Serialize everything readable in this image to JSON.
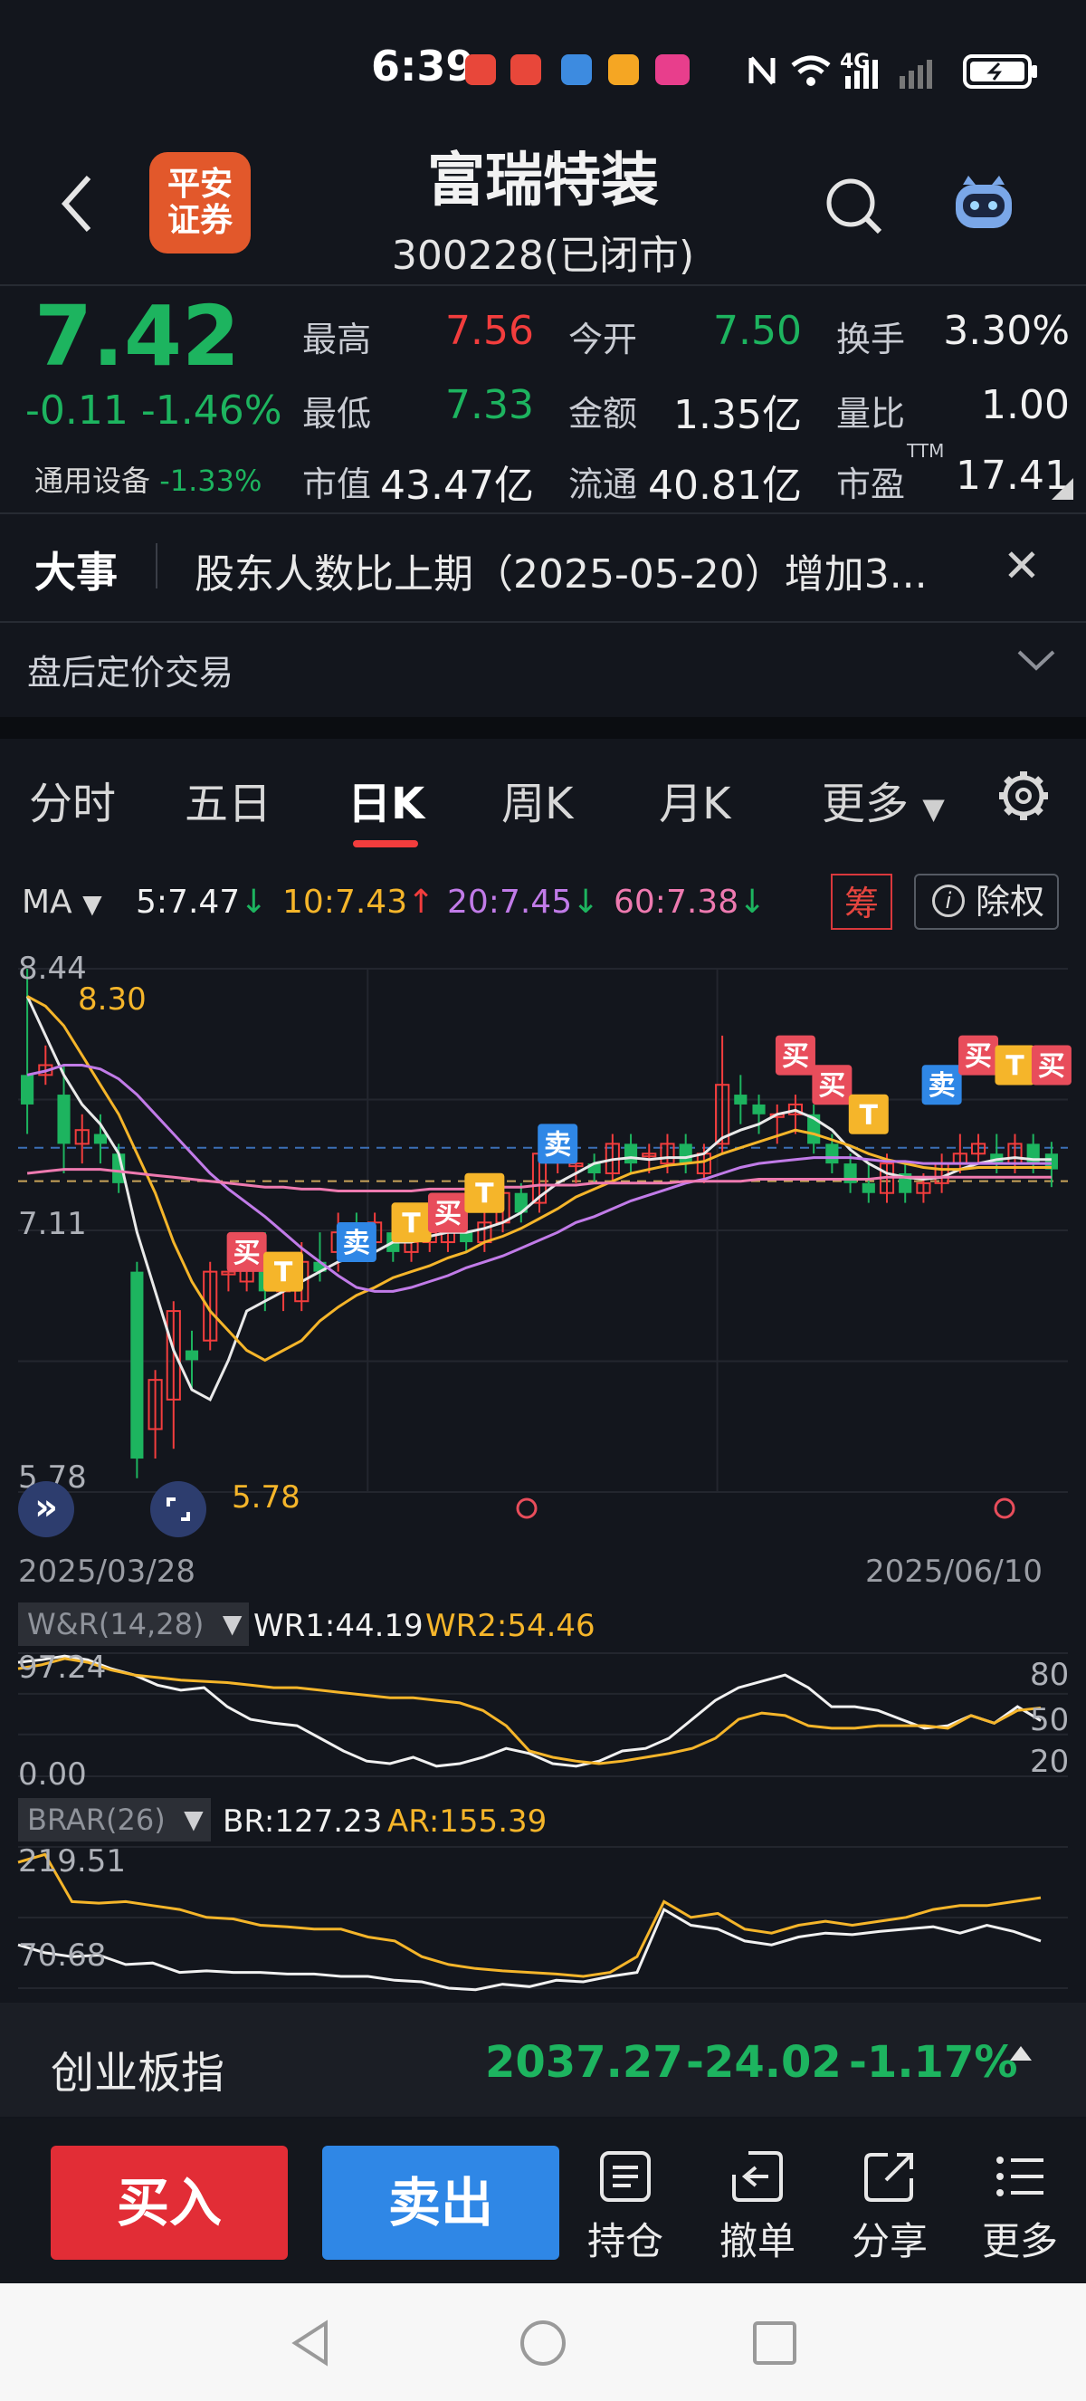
{
  "status_bar": {
    "time": "6:39",
    "network": "4G"
  },
  "header": {
    "broker_logo": "平安\n证券",
    "stock_name": "富瑞特装",
    "stock_code": "300228(已闭市)"
  },
  "quote": {
    "price": "7.42",
    "change": "-0.11",
    "change_pct": "-1.46%",
    "sector_name": "通用设备",
    "sector_pct": "-1.33%",
    "fields": [
      {
        "label": "最高",
        "value": "7.56",
        "color": "#f23d3d"
      },
      {
        "label": "今开",
        "value": "7.50",
        "color": "#1db45f"
      },
      {
        "label": "换手",
        "value": "3.30%",
        "color": "#f1f1f1"
      },
      {
        "label": "最低",
        "value": "7.33",
        "color": "#1db45f"
      },
      {
        "label": "金额",
        "value": "1.35亿",
        "color": "#f1f1f1"
      },
      {
        "label": "量比",
        "value": "1.00",
        "color": "#f1f1f1"
      },
      {
        "label": "市值",
        "value": "43.47亿",
        "color": "#f1f1f1"
      },
      {
        "label": "流通",
        "value": "40.81亿",
        "color": "#f1f1f1"
      },
      {
        "label": "市盈",
        "value": "17.41",
        "color": "#f1f1f1",
        "superscript": "TTM"
      }
    ]
  },
  "news": {
    "tag": "大事",
    "text": "股东人数比上期（2025-05-20）增加3...",
    "after_hours": "盘后定价交易"
  },
  "tabs": [
    {
      "label": "分时",
      "active": false
    },
    {
      "label": "五日",
      "active": false
    },
    {
      "label": "日K",
      "active": true
    },
    {
      "label": "周K",
      "active": false
    },
    {
      "label": "月K",
      "active": false
    },
    {
      "label": "更多",
      "active": false
    }
  ],
  "ma_row": {
    "label": "MA",
    "items": [
      {
        "text": "5:7.47",
        "arrow": "↓",
        "color": "#f1f1f1",
        "arrow_color": "#1db45f"
      },
      {
        "text": "10:7.43",
        "arrow": "↑",
        "color": "#f5b52a",
        "arrow_color": "#f23d3d"
      },
      {
        "text": "20:7.45",
        "arrow": "↓",
        "color": "#c17be8",
        "arrow_color": "#1db45f"
      },
      {
        "text": "60:7.38",
        "arrow": "↓",
        "color": "#ee7ab0",
        "arrow_color": "#1db45f"
      }
    ],
    "chou_label": "筹",
    "chuquan_label": "除权"
  },
  "kline": {
    "y_high_label": "8.44",
    "y_mid_label": "7.11",
    "y_low_label": "5.78",
    "max_marker": "8.30",
    "min_marker": "5.78",
    "date_start": "2025/03/28",
    "date_end": "2025/06/10",
    "signal_buy": "买",
    "signal_sell": "卖",
    "signal_t": "T"
  },
  "chart_data": [
    {
      "type": "candlestick",
      "title": "日K",
      "x_range": [
        "2025/03/28",
        "2025/06/10"
      ],
      "ylim": [
        5.78,
        8.44
      ],
      "y_ticks": [
        8.44,
        7.11,
        5.78
      ],
      "candles": [
        {
          "o": 7.9,
          "c": 7.75,
          "h": 8.44,
          "l": 7.6
        },
        {
          "o": 7.9,
          "c": 7.95,
          "h": 8.05,
          "l": 7.85
        },
        {
          "o": 7.8,
          "c": 7.55,
          "h": 7.95,
          "l": 7.4
        },
        {
          "o": 7.55,
          "c": 7.62,
          "h": 7.7,
          "l": 7.45
        },
        {
          "o": 7.6,
          "c": 7.55,
          "h": 7.7,
          "l": 7.45
        },
        {
          "o": 7.5,
          "c": 7.35,
          "h": 7.55,
          "l": 7.3
        },
        {
          "o": 6.9,
          "c": 5.95,
          "h": 6.95,
          "l": 5.85
        },
        {
          "o": 6.1,
          "c": 6.35,
          "h": 6.4,
          "l": 5.95
        },
        {
          "o": 6.25,
          "c": 6.7,
          "h": 6.75,
          "l": 6.0
        },
        {
          "o": 6.5,
          "c": 6.45,
          "h": 6.6,
          "l": 6.3
        },
        {
          "o": 6.55,
          "c": 6.9,
          "h": 6.95,
          "l": 6.5
        },
        {
          "o": 6.9,
          "c": 6.9,
          "h": 6.95,
          "l": 6.8
        },
        {
          "o": 6.85,
          "c": 6.95,
          "h": 7.05,
          "l": 6.8
        },
        {
          "o": 6.95,
          "c": 6.8,
          "h": 7.1,
          "l": 6.7
        },
        {
          "o": 6.8,
          "c": 6.85,
          "h": 6.95,
          "l": 6.7
        },
        {
          "o": 6.75,
          "c": 6.95,
          "h": 7.05,
          "l": 6.7
        },
        {
          "o": 6.95,
          "c": 6.9,
          "h": 7.1,
          "l": 6.85
        },
        {
          "o": 7.0,
          "c": 7.1,
          "h": 7.2,
          "l": 6.9
        },
        {
          "o": 7.1,
          "c": 7.05,
          "h": 7.2,
          "l": 6.95
        },
        {
          "o": 7.05,
          "c": 7.15,
          "h": 7.2,
          "l": 7.0
        },
        {
          "o": 7.1,
          "c": 7.0,
          "h": 7.15,
          "l": 6.95
        },
        {
          "o": 7.0,
          "c": 7.05,
          "h": 7.2,
          "l": 6.95
        },
        {
          "o": 7.05,
          "c": 7.1,
          "h": 7.15,
          "l": 7.0
        },
        {
          "o": 7.05,
          "c": 7.15,
          "h": 7.25,
          "l": 7.0
        },
        {
          "o": 7.1,
          "c": 7.05,
          "h": 7.15,
          "l": 7.0
        },
        {
          "o": 7.05,
          "c": 7.15,
          "h": 7.2,
          "l": 7.0
        },
        {
          "o": 7.15,
          "c": 7.3,
          "h": 7.35,
          "l": 7.1
        },
        {
          "o": 7.3,
          "c": 7.2,
          "h": 7.35,
          "l": 7.15
        },
        {
          "o": 7.25,
          "c": 7.5,
          "h": 7.6,
          "l": 7.2
        },
        {
          "o": 7.5,
          "c": 7.55,
          "h": 7.6,
          "l": 7.4
        },
        {
          "o": 7.45,
          "c": 7.45,
          "h": 7.55,
          "l": 7.35
        },
        {
          "o": 7.45,
          "c": 7.4,
          "h": 7.5,
          "l": 7.35
        },
        {
          "o": 7.4,
          "c": 7.55,
          "h": 7.6,
          "l": 7.35
        },
        {
          "o": 7.55,
          "c": 7.45,
          "h": 7.6,
          "l": 7.4
        },
        {
          "o": 7.5,
          "c": 7.5,
          "h": 7.55,
          "l": 7.4
        },
        {
          "o": 7.45,
          "c": 7.55,
          "h": 7.6,
          "l": 7.4
        },
        {
          "o": 7.55,
          "c": 7.45,
          "h": 7.6,
          "l": 7.4
        },
        {
          "o": 7.4,
          "c": 7.5,
          "h": 7.55,
          "l": 7.35
        },
        {
          "o": 7.55,
          "c": 7.85,
          "h": 8.1,
          "l": 7.5
        },
        {
          "o": 7.8,
          "c": 7.75,
          "h": 7.9,
          "l": 7.65
        },
        {
          "o": 7.75,
          "c": 7.7,
          "h": 7.8,
          "l": 7.6
        },
        {
          "o": 7.7,
          "c": 7.7,
          "h": 7.75,
          "l": 7.55
        },
        {
          "o": 7.7,
          "c": 7.75,
          "h": 7.8,
          "l": 7.6
        },
        {
          "o": 7.7,
          "c": 7.55,
          "h": 7.75,
          "l": 7.5
        },
        {
          "o": 7.55,
          "c": 7.45,
          "h": 7.6,
          "l": 7.4
        },
        {
          "o": 7.45,
          "c": 7.35,
          "h": 7.5,
          "l": 7.3
        },
        {
          "o": 7.35,
          "c": 7.3,
          "h": 7.45,
          "l": 7.25
        },
        {
          "o": 7.3,
          "c": 7.45,
          "h": 7.5,
          "l": 7.25
        },
        {
          "o": 7.4,
          "c": 7.3,
          "h": 7.45,
          "l": 7.25
        },
        {
          "o": 7.3,
          "c": 7.35,
          "h": 7.4,
          "l": 7.25
        },
        {
          "o": 7.35,
          "c": 7.45,
          "h": 7.5,
          "l": 7.3
        },
        {
          "o": 7.45,
          "c": 7.5,
          "h": 7.6,
          "l": 7.4
        },
        {
          "o": 7.5,
          "c": 7.55,
          "h": 7.6,
          "l": 7.45
        },
        {
          "o": 7.5,
          "c": 7.45,
          "h": 7.6,
          "l": 7.4
        },
        {
          "o": 7.45,
          "c": 7.55,
          "h": 7.6,
          "l": 7.4
        },
        {
          "o": 7.55,
          "c": 7.45,
          "h": 7.6,
          "l": 7.4
        },
        {
          "o": 7.5,
          "c": 7.42,
          "h": 7.56,
          "l": 7.33
        }
      ],
      "series": [
        {
          "name": "MA5",
          "color": "#e9e9e9",
          "values": [
            8.3,
            8.1,
            7.9,
            7.75,
            7.65,
            7.5,
            7.1,
            6.8,
            6.5,
            6.3,
            6.25,
            6.45,
            6.7,
            6.75,
            6.8,
            6.85,
            6.9,
            6.95,
            6.98,
            7.0,
            7.05,
            7.05,
            7.08,
            7.1,
            7.1,
            7.12,
            7.15,
            7.2,
            7.28,
            7.35,
            7.4,
            7.45,
            7.47,
            7.48,
            7.47,
            7.48,
            7.48,
            7.5,
            7.58,
            7.62,
            7.65,
            7.7,
            7.72,
            7.68,
            7.62,
            7.52,
            7.45,
            7.4,
            7.38,
            7.37,
            7.38,
            7.42,
            7.45,
            7.47,
            7.48,
            7.47,
            7.47
          ]
        },
        {
          "name": "MA10",
          "color": "#f5b52a",
          "values": [
            8.3,
            8.25,
            8.15,
            8.0,
            7.85,
            7.7,
            7.5,
            7.3,
            7.05,
            6.85,
            6.7,
            6.6,
            6.5,
            6.45,
            6.5,
            6.55,
            6.65,
            6.72,
            6.78,
            6.82,
            6.87,
            6.9,
            6.93,
            6.97,
            7.0,
            7.05,
            7.08,
            7.12,
            7.17,
            7.22,
            7.28,
            7.32,
            7.36,
            7.4,
            7.42,
            7.44,
            7.45,
            7.46,
            7.5,
            7.53,
            7.56,
            7.59,
            7.62,
            7.6,
            7.57,
            7.54,
            7.5,
            7.47,
            7.45,
            7.43,
            7.42,
            7.42,
            7.43,
            7.43,
            7.43,
            7.43,
            7.43
          ]
        },
        {
          "name": "MA20",
          "color": "#c17be8",
          "values": [
            7.9,
            7.92,
            7.95,
            7.95,
            7.93,
            7.88,
            7.8,
            7.7,
            7.6,
            7.5,
            7.4,
            7.32,
            7.25,
            7.18,
            7.1,
            7.02,
            6.95,
            6.88,
            6.82,
            6.8,
            6.8,
            6.82,
            6.85,
            6.88,
            6.92,
            6.95,
            6.98,
            7.02,
            7.06,
            7.1,
            7.15,
            7.18,
            7.22,
            7.26,
            7.29,
            7.32,
            7.35,
            7.37,
            7.4,
            7.43,
            7.45,
            7.46,
            7.47,
            7.48,
            7.48,
            7.48,
            7.47,
            7.46,
            7.46,
            7.45,
            7.45,
            7.45,
            7.45,
            7.45,
            7.45,
            7.45,
            7.45
          ]
        },
        {
          "name": "MA60",
          "color": "#ee7ab0",
          "values": [
            7.4,
            7.41,
            7.42,
            7.42,
            7.42,
            7.41,
            7.4,
            7.39,
            7.38,
            7.37,
            7.36,
            7.35,
            7.34,
            7.33,
            7.33,
            7.32,
            7.32,
            7.31,
            7.31,
            7.31,
            7.31,
            7.31,
            7.32,
            7.32,
            7.32,
            7.33,
            7.33,
            7.33,
            7.34,
            7.34,
            7.34,
            7.35,
            7.35,
            7.35,
            7.35,
            7.35,
            7.36,
            7.36,
            7.36,
            7.36,
            7.37,
            7.37,
            7.37,
            7.37,
            7.37,
            7.37,
            7.37,
            7.38,
            7.38,
            7.38,
            7.38,
            7.38,
            7.38,
            7.38,
            7.38,
            7.38,
            7.38
          ]
        }
      ]
    },
    {
      "type": "line",
      "title": "W&R(14,28)",
      "y_labels_left": [
        "97.24",
        "0.00"
      ],
      "y_labels_right": [
        "80",
        "50",
        "20"
      ],
      "ylim": [
        0,
        97.24
      ],
      "series": [
        {
          "name": "WR1",
          "color": "#f1f1f1",
          "values": [
            90,
            92,
            95,
            92,
            85,
            80,
            72,
            68,
            70,
            55,
            45,
            42,
            40,
            30,
            20,
            12,
            10,
            15,
            8,
            10,
            15,
            22,
            18,
            10,
            8,
            12,
            20,
            22,
            30,
            45,
            60,
            70,
            75,
            80,
            70,
            55,
            55,
            52,
            45,
            38,
            40,
            48,
            42,
            55,
            44
          ]
        },
        {
          "name": "WR2",
          "color": "#f5b52a",
          "values": [
            85,
            88,
            93,
            90,
            84,
            80,
            78,
            76,
            75,
            74,
            72,
            70,
            70,
            68,
            66,
            64,
            62,
            62,
            60,
            58,
            52,
            40,
            20,
            15,
            12,
            10,
            12,
            15,
            18,
            22,
            30,
            45,
            50,
            48,
            40,
            38,
            38,
            40,
            40,
            40,
            38,
            48,
            42,
            52,
            54
          ]
        }
      ]
    },
    {
      "type": "line",
      "title": "BRAR(26)",
      "y_labels_left": [
        "219.51",
        "70.68"
      ],
      "ylim": [
        40,
        219.51
      ],
      "series": [
        {
          "name": "BR",
          "color": "#f1f1f1",
          "values": [
            95,
            85,
            80,
            82,
            70,
            72,
            60,
            62,
            60,
            60,
            58,
            58,
            55,
            55,
            50,
            48,
            40,
            38,
            45,
            42,
            50,
            48,
            55,
            60,
            140,
            120,
            115,
            100,
            95,
            105,
            110,
            108,
            112,
            115,
            118,
            110,
            120,
            112,
            100
          ]
        },
        {
          "name": "AR",
          "color": "#f5b52a",
          "values": [
            200,
            210,
            150,
            148,
            150,
            145,
            140,
            130,
            128,
            120,
            118,
            115,
            115,
            105,
            100,
            80,
            70,
            65,
            62,
            60,
            58,
            55,
            60,
            80,
            150,
            130,
            135,
            115,
            110,
            120,
            125,
            120,
            125,
            130,
            140,
            145,
            145,
            150,
            155
          ]
        }
      ]
    }
  ],
  "indicators": {
    "wr_tag": "W&R(14,28)",
    "wr1": "WR1:44.19",
    "wr2": "WR2:54.46",
    "wr_top": "97.24",
    "wr_bottom": "0.00",
    "wr_right": [
      "80",
      "50",
      "20"
    ],
    "brar_tag": "BRAR(26)",
    "br": "BR:127.23",
    "ar": "AR:155.39",
    "brar_top": "219.51",
    "brar_bottom": "70.68"
  },
  "index_bar": {
    "name": "创业板指",
    "value": "2037.27",
    "change": "-24.02",
    "change_pct": "-1.17%"
  },
  "toolbar": {
    "buy": "买入",
    "sell": "卖出",
    "tools": [
      {
        "label": "持仓",
        "icon": "holdings-icon"
      },
      {
        "label": "撤单",
        "icon": "cancel-order-icon"
      },
      {
        "label": "分享",
        "icon": "share-icon"
      },
      {
        "label": "更多",
        "icon": "more-list-icon"
      }
    ]
  },
  "colors": {
    "up": "#f23d3d",
    "down": "#1db45f",
    "background": "#13161d",
    "buy_button": "#e22d36",
    "sell_button": "#2f87e6"
  }
}
